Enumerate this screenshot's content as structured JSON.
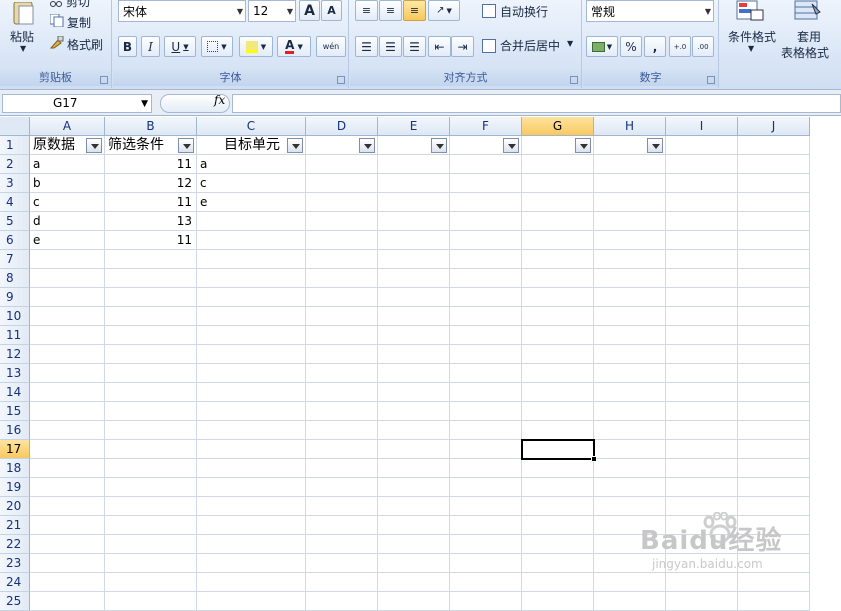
{
  "ribbon": {
    "clipboard": {
      "label": "剪贴板",
      "paste": "粘贴",
      "cut": "剪切",
      "copy": "复制",
      "format_painter": "格式刷"
    },
    "font": {
      "label": "字体",
      "font_name": "宋体",
      "font_size": "12",
      "bold": "B",
      "italic": "I",
      "underline": "U",
      "grow": "A",
      "shrink": "A",
      "font_color": "A",
      "phonetic": "wén"
    },
    "alignment": {
      "label": "对齐方式",
      "wrap_text": "自动换行",
      "merge_center": "合并后居中"
    },
    "number": {
      "label": "数字",
      "format": "常规",
      "percent": "%",
      "comma": ",",
      "increase_decimal": "+.0",
      "decrease_decimal": ".00"
    },
    "styles": {
      "conditional": "条件格式",
      "table_format_1": "套用",
      "table_format_2": "表格格式"
    }
  },
  "formula_bar": {
    "name_box": "G17",
    "fx": "fx",
    "content": ""
  },
  "sheet": {
    "columns": [
      "A",
      "B",
      "C",
      "D",
      "E",
      "F",
      "G",
      "H",
      "I",
      "J"
    ],
    "rows": [
      "1",
      "2",
      "3",
      "4",
      "5",
      "6",
      "7",
      "8",
      "9",
      "10",
      "11",
      "12",
      "13",
      "14",
      "15",
      "16",
      "17",
      "18",
      "19",
      "20",
      "21",
      "22",
      "23",
      "24",
      "25"
    ],
    "header_row": {
      "A": "原数据",
      "B": "筛选条件",
      "C": "目标单元"
    },
    "A": [
      "a",
      "b",
      "c",
      "d",
      "e"
    ],
    "B": [
      "11",
      "12",
      "11",
      "13",
      "11"
    ],
    "C": [
      "a",
      "c",
      "e"
    ],
    "active_cell": "G17",
    "active_column": "G",
    "active_row": "17"
  },
  "watermark": {
    "brand": "Baidu经验",
    "url": "jingyan.baidu.com"
  },
  "colors": {
    "ribbon_bg": "#dbe7f7",
    "group_label": "#3b5998",
    "active_header": "#f9c960",
    "gridline": "#d0d7e5"
  }
}
